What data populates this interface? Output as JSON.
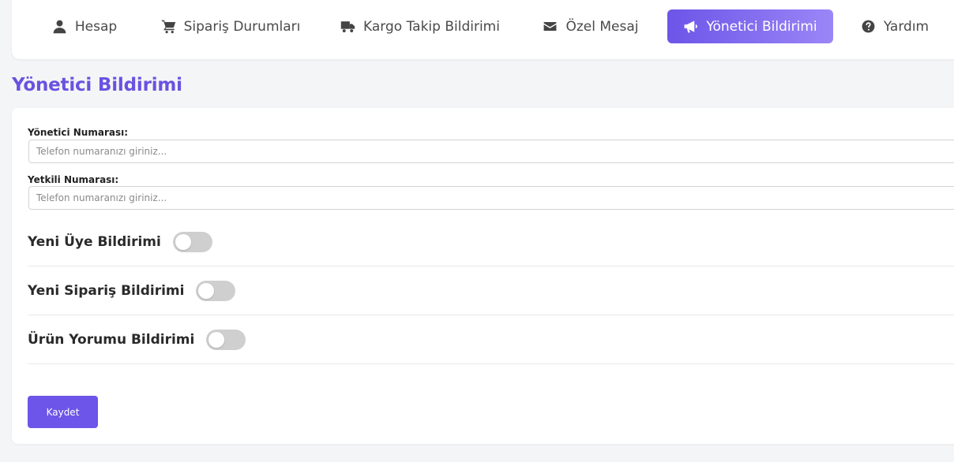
{
  "nav": {
    "items": [
      {
        "label": "Hesap",
        "icon": "user-icon",
        "active": false
      },
      {
        "label": "Sipariş Durumları",
        "icon": "cart-icon",
        "active": false
      },
      {
        "label": "Kargo Takip Bildirimi",
        "icon": "truck-icon",
        "active": false
      },
      {
        "label": "Özel Mesaj",
        "icon": "envelope-icon",
        "active": false
      },
      {
        "label": "Yönetici Bildirimi",
        "icon": "megaphone-icon",
        "active": true
      },
      {
        "label": "Yardım",
        "icon": "question-circle-icon",
        "active": false
      }
    ]
  },
  "page": {
    "title": "Yönetici Bildirimi"
  },
  "form": {
    "admin_number": {
      "label": "Yönetici Numarası:",
      "value": "",
      "placeholder": "Telefon numaranızı giriniz..."
    },
    "authorized_number": {
      "label": "Yetkili Numarası:",
      "value": "",
      "placeholder": "Telefon numaranızı giriniz..."
    },
    "toggles": [
      {
        "label": "Yeni Üye Bildirimi",
        "enabled": false
      },
      {
        "label": "Yeni Sipariş Bildirimi",
        "enabled": false
      },
      {
        "label": "Ürün Yorumu Bildirimi",
        "enabled": false
      }
    ],
    "save_label": "Kaydet"
  },
  "colors": {
    "accent": "#6c55e8",
    "accent_gradient_end": "#9b86f7",
    "title": "#6a52e0",
    "toggle_off": "#cfcfcf"
  }
}
